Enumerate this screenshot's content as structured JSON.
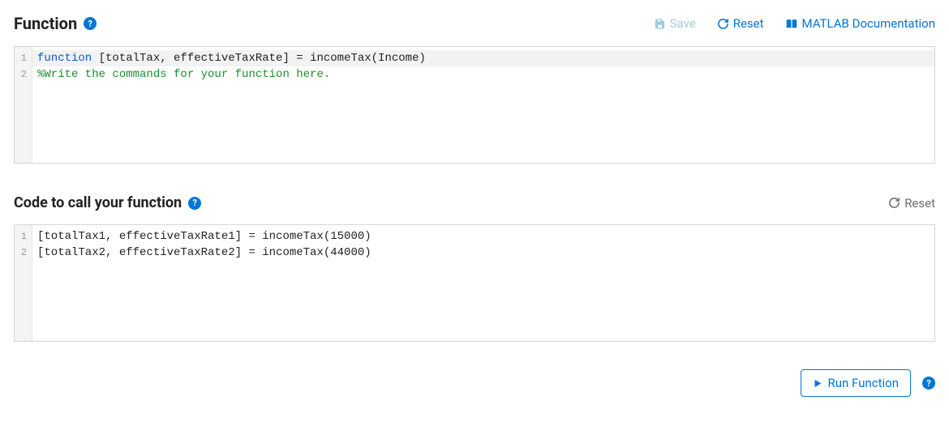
{
  "function_section": {
    "title": "Function",
    "save_label": "Save",
    "reset_label": "Reset",
    "docs_label": "MATLAB Documentation",
    "code": {
      "line_numbers": [
        "1",
        "2"
      ],
      "line1": {
        "kw": "function",
        "rest": " [totalTax, effectiveTaxRate] = incomeTax(Income)"
      },
      "line2": "%Write the commands for your function here."
    }
  },
  "call_section": {
    "title": "Code to call your function",
    "reset_label": "Reset",
    "code": {
      "line_numbers": [
        "1",
        "2"
      ],
      "line1": "[totalTax1, effectiveTaxRate1] = incomeTax(15000)",
      "line2": "[totalTax2, effectiveTaxRate2] = incomeTax(44000)"
    }
  },
  "footer": {
    "run_label": "Run Function"
  }
}
